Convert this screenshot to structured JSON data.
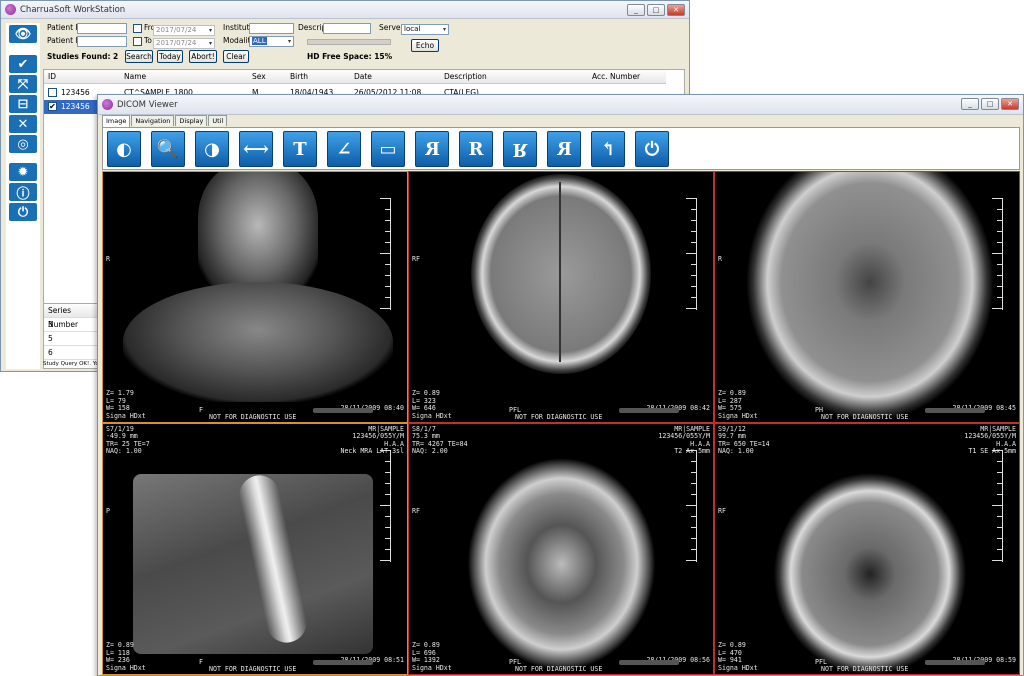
{
  "workstation": {
    "title": "CharruaSoft WorkStation",
    "form": {
      "patient_id_label": "Patient ID",
      "patient_name_label": "Patient Na",
      "from_label": "Fro",
      "from_date": "2017/07/24",
      "to_label": "To",
      "to_date": "2017/07/24",
      "institution_label": "Institutio",
      "modality_label": "Modality",
      "modality_value": "ALL",
      "description_label": "Descripti",
      "server_label": "Server",
      "server_value": "local",
      "echo_button": "Echo",
      "studies_found": "Studies Found: 2",
      "search_button": "Search",
      "today_button": "Today",
      "abort_button": "Abort!",
      "clear_button": "Clear",
      "hd_free_space": "HD Free Space: 15%"
    },
    "table": {
      "columns": [
        "ID",
        "Name",
        "Sex",
        "Birth",
        "Date",
        "Description",
        "Acc. Number"
      ],
      "rows": [
        {
          "id": "123456",
          "name": "CT^SAMPLE_1800",
          "sex": "M",
          "birth": "18/04/1943",
          "date": "26/05/2012 11:08",
          "description": "CTA(LEG)",
          "acc": ""
        },
        {
          "id": "123456",
          "name": "",
          "sex": "",
          "birth": "",
          "date": "",
          "description": "",
          "acc": ""
        }
      ]
    },
    "series": {
      "header": "Series Number",
      "values": [
        "3",
        "5",
        "6"
      ]
    },
    "status": "Study Query OK!. You"
  },
  "viewer": {
    "title": "DICOM Viewer",
    "tabs": [
      "Image",
      "Navigation",
      "Display",
      "Util"
    ],
    "tools": [
      {
        "name": "window-level-icon",
        "glyph": "◐"
      },
      {
        "name": "zoom-icon",
        "glyph": "🔍"
      },
      {
        "name": "invert-icon",
        "glyph": "◑"
      },
      {
        "name": "measure-icon",
        "glyph": "⟷"
      },
      {
        "name": "text-icon",
        "glyph": "T"
      },
      {
        "name": "angle-icon",
        "glyph": "∠"
      },
      {
        "name": "roi-icon",
        "glyph": "▭"
      },
      {
        "name": "rotate-left-icon",
        "glyph": "R"
      },
      {
        "name": "rotate-right-icon",
        "glyph": "R"
      },
      {
        "name": "flip-vertical-icon",
        "glyph": "R"
      },
      {
        "name": "flip-horizontal-icon",
        "glyph": "R"
      },
      {
        "name": "reset-icon",
        "glyph": "↰"
      },
      {
        "name": "power-icon",
        "glyph": "⏻"
      }
    ],
    "viewports": [
      {
        "tl": "",
        "tr": "",
        "left": "R",
        "bl": "Z= 1.79\nL= 79\nW= 158\nSigna HDxt",
        "bc": "F",
        "br": "28/11/2009 08:40",
        "footer": "NOT FOR DIAGNOSTIC USE",
        "kind": "coronal"
      },
      {
        "tl": "",
        "tr": "",
        "left": "RF",
        "bl": "Z= 0.89\nL= 323\nW= 646\nSigna HDxt",
        "bc": "PFL",
        "br": "28/11/2009 08:42",
        "footer": "NOT FOR DIAGNOSTIC USE",
        "kind": "axial-top"
      },
      {
        "tl": "",
        "tr": "",
        "left": "R",
        "bl": "Z= 0.89\nL= 287\nW= 575\nSigna HDxt",
        "bc": "PH",
        "br": "28/11/2009 08:45",
        "footer": "NOT FOR DIAGNOSTIC USE",
        "kind": "axial-mid"
      },
      {
        "tl": "S7/1/19\n-49.9 mm\nTR= 25 TE=7\nNAQ: 1.00",
        "tr": "MR|SAMPLE\n123456/055Y/M\nH.A.A\nNeck MRA LAT 3sl",
        "left": "P",
        "bl": "Z= 0.89\nL= 118\nW= 236\nSigna HDxt",
        "bc": "F",
        "br": "28/11/2009 08:51",
        "footer": "NOT FOR DIAGNOSTIC USE",
        "kind": "mra"
      },
      {
        "tl": "S8/1/7\n75.3 mm\nTR= 4267 TE=84\nNAQ: 2.00",
        "tr": "MR|SAMPLE\n123456/055Y/M\nH.A.A\nT2 Ax 5mm",
        "left": "RF",
        "bl": "Z= 0.89\nL= 696\nW= 1392\nSigna HDxt",
        "bc": "PFL",
        "br": "28/11/2009 08:56",
        "footer": "NOT FOR DIAGNOSTIC USE",
        "kind": "t2"
      },
      {
        "tl": "S9/1/12\n99.7 mm\nTR= 650 TE=14\nNAQ: 1.00",
        "tr": "MR|SAMPLE\n123456/055Y/M\nH.A.A\nT1 SE Ax 5mm",
        "left": "RF",
        "bl": "Z= 0.89\nL= 470\nW= 941\nSigna HDxt",
        "bc": "PFL",
        "br": "28/11/2009 08:59",
        "footer": "NOT FOR DIAGNOSTIC USE",
        "kind": "t1"
      }
    ]
  }
}
